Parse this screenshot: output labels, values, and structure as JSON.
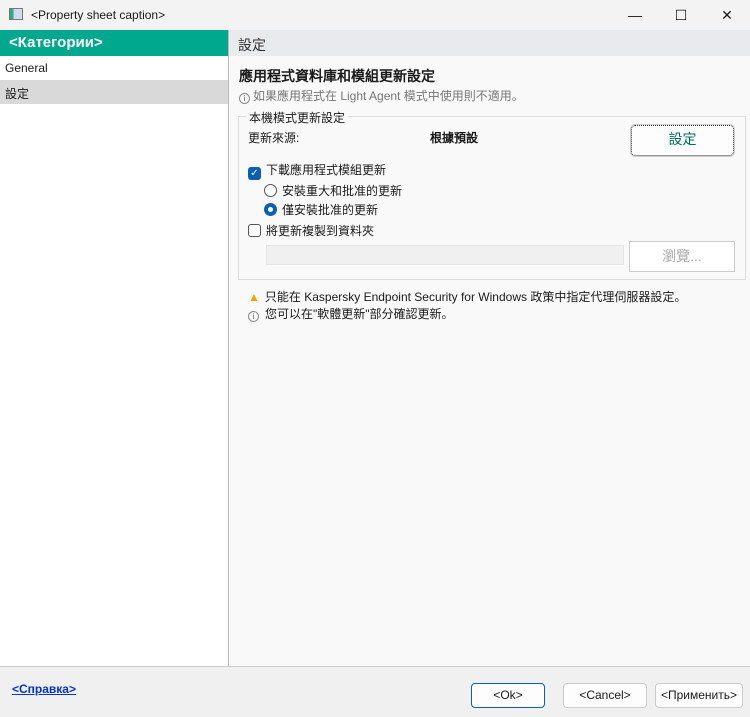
{
  "window": {
    "title": "<Property sheet caption>",
    "minimize": "—",
    "maximize": "☐",
    "close": "✕"
  },
  "sidebar": {
    "header": "<Категории>",
    "items": [
      {
        "label": "General"
      },
      {
        "label": "設定"
      }
    ]
  },
  "content": {
    "header": "設定",
    "title": "應用程式資料庫和模組更新設定",
    "note": "如果應用程式在 Light Agent 模式中使用則不適用。",
    "group": {
      "label": "本機模式更新設定",
      "source_label": "更新來源:",
      "source_value": "根據預設",
      "settings_button": "設定",
      "download_modules": {
        "label": "下載應用程式模組更新",
        "checked": true
      },
      "radio_options": [
        {
          "label": "安裝重大和批准的更新",
          "selected": false
        },
        {
          "label": "僅安裝批准的更新",
          "selected": true
        }
      ],
      "copy_to_folder": {
        "label": "將更新複製到資料夾",
        "checked": false
      },
      "folder_path": "",
      "browse_button": "瀏覽..."
    },
    "warning": "只能在 Kaspersky Endpoint Security for Windows 政策中指定代理伺服器設定。",
    "info": "您可以在\"軟體更新\"部分確認更新。"
  },
  "footer": {
    "help": "<Справка>",
    "ok": "<Ok>",
    "cancel": "<Cancel>",
    "apply": "<Применить>"
  },
  "colors": {
    "accent": "#00a88e",
    "check": "#0a5fb4"
  }
}
